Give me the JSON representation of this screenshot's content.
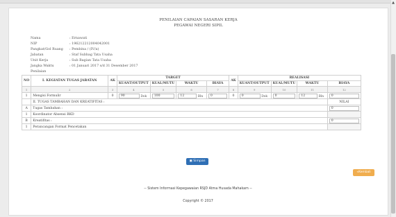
{
  "header": {
    "title": "PENILAIAN CAPAIAN SASARAN KERJA",
    "subtitle": "PEGAWAI NEGERI SIPIL"
  },
  "info": [
    {
      "label": "Nama",
      "value": ": Ernawati"
    },
    {
      "label": "NIP",
      "value": ": 196212212004042001"
    },
    {
      "label": "Pangkat/Gol Ruang",
      "value": ": Pembina / (IV/a)"
    },
    {
      "label": "Jabatan",
      "value": ": Staf Subbag Tata Usaha"
    },
    {
      "label": "Unit Kerja",
      "value": ": Sub Bagian Tata Usaha"
    },
    {
      "label": "Jangka Waktu Penilaian",
      "value": ": 01 Januari 2017  s/d  31 Desember 2017"
    }
  ],
  "table": {
    "h_no": "NO",
    "h_kegiatan": "I. KEGIATAN TUGAS JABATAN",
    "h_ak": "AK",
    "h_target": "TARGET",
    "h_realisasi": "REALISASI",
    "h_kuant": "KUANT/OUTPUT",
    "h_kual": "KUAL/MUTU",
    "h_waktu": "WAKTU",
    "h_biaya": "BIAYA",
    "nums": [
      "1",
      "2",
      "3",
      "4",
      "5",
      "6",
      "7",
      "8",
      "9",
      "10",
      "11",
      "12"
    ],
    "row1": {
      "no": "1",
      "kegiatan": "Mengisi Formulir",
      "ak_t": "0",
      "t_kuant": "90",
      "t_kuant_unit": "Dok",
      "t_kual": "100",
      "t_waktu": "12",
      "t_waktu_unit": "Bln",
      "t_biaya": "0",
      "ak_r": "0",
      "r_kuant": "0",
      "r_kuant_unit": "Dok",
      "r_kual": "0",
      "r_waktu": "12",
      "r_waktu_unit": "Bln",
      "r_biaya": "0"
    },
    "section2": "II. TUGAS TAMBAHAN DAN KREATIFITAS :",
    "nilai": "NILAI",
    "a_letter": "A",
    "a_label": "Tugas Tambahan :",
    "a_value": "0",
    "a_item_no": "1",
    "a_item": "Koordinator Absensi BKD",
    "b_letter": "B",
    "b_label": "Kreatifitas :",
    "b_value": "0",
    "b_item_no": "1",
    "b_item": "Perancangan Format Pencetakan"
  },
  "buttons": {
    "save": "Simpan",
    "back": "Kembali"
  },
  "footer": {
    "line1": "-- Sistem Informasi Kepegawaian RSJD Atma Husada Mahakam --",
    "line2": "Copyright © 2017"
  }
}
